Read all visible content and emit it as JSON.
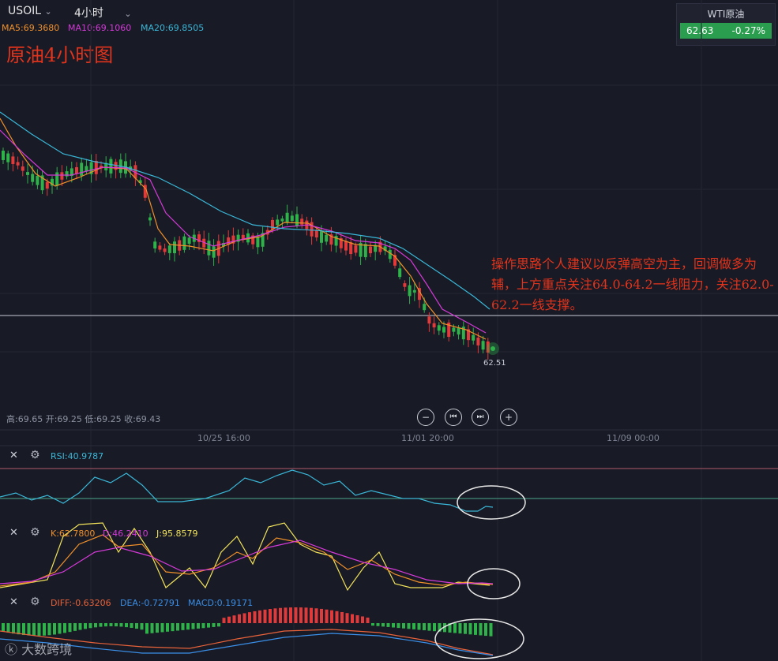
{
  "header": {
    "symbol": "USOIL",
    "timeframe": "4小时"
  },
  "ma": {
    "ma5": "MA5:69.3680",
    "ma10": "MA10:69.1060",
    "ma20": "MA20:69.8505"
  },
  "chart_title": "原油4小时图",
  "ticker": {
    "name": "WTI原油",
    "price": "62.63",
    "change": "-0.27%"
  },
  "note": "操作思路个人建议以反弹高空为主，回调做多为辅，上方重点关注64.0-64.2一线阻力，关注62.0-62.2一线支撑。",
  "last_price_label": "62.51",
  "ohlc": "高:69.65 开:69.25 低:69.25 收:69.43",
  "controls": {
    "zoom_out": "−",
    "prev": "⏮",
    "next": "⏭",
    "zoom_in": "+"
  },
  "x_axis": [
    "10/25 16:00",
    "11/01 20:00",
    "11/09 00:00"
  ],
  "rsi": {
    "label": "RSI:40.9787"
  },
  "kdj": {
    "k": "K:62.7800",
    "d": "D:46.2410",
    "j": "J:95.8579"
  },
  "macd": {
    "diff": "DIFF:-0.63206",
    "dea": "DEA:-0.72791",
    "macd": "MACD:0.19171"
  },
  "watermark": "大数跨境",
  "colors": {
    "up": "#e03a3a",
    "down": "#2fb24a",
    "ma5": "#f0902a",
    "ma10": "#d43ad8",
    "ma20": "#3ab7d8",
    "annotation": "#e2341c"
  },
  "icons": {
    "close": "close-icon",
    "settings": "gear-icon",
    "dropdown": "chevron-down-icon"
  }
}
